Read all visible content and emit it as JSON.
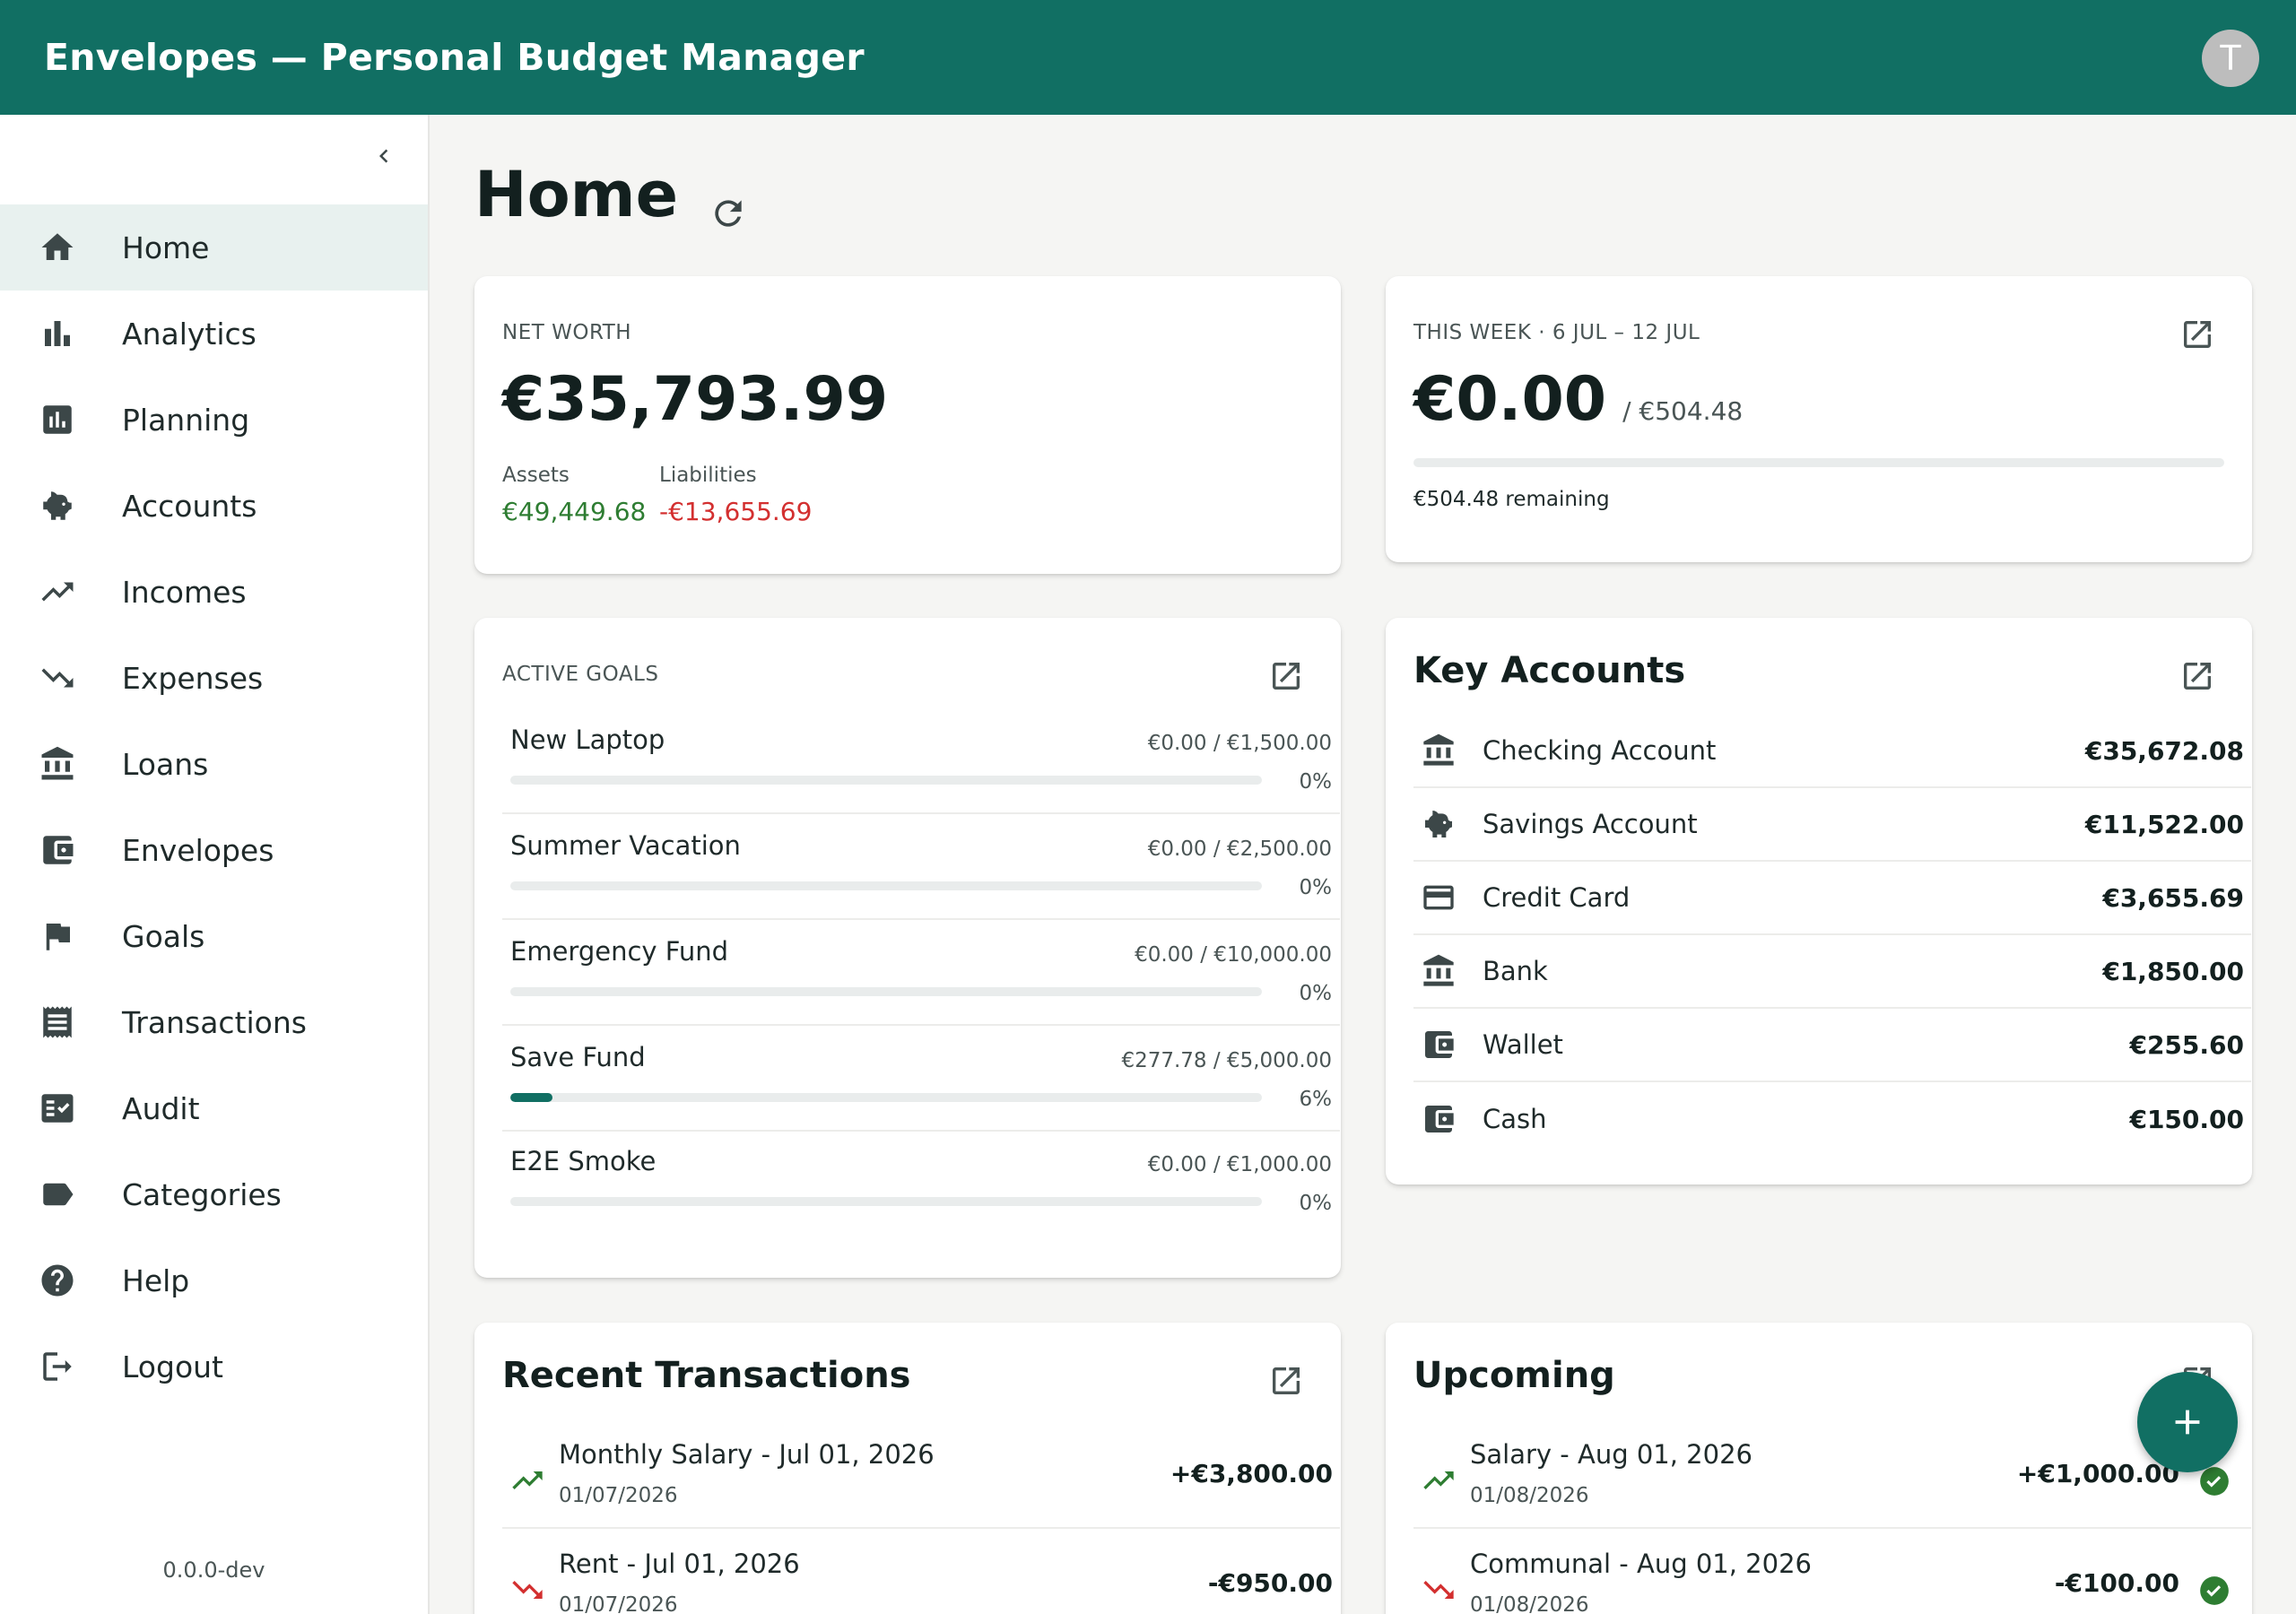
{
  "app": {
    "title": "Envelopes — Personal Budget Manager",
    "avatar_initial": "T"
  },
  "sidebar": {
    "items": [
      {
        "label": "Home",
        "icon": "home-icon",
        "active": true
      },
      {
        "label": "Analytics",
        "icon": "bar-chart-icon"
      },
      {
        "label": "Planning",
        "icon": "planning-chart-icon"
      },
      {
        "label": "Accounts",
        "icon": "piggy-bank-icon"
      },
      {
        "label": "Incomes",
        "icon": "trending-up-icon"
      },
      {
        "label": "Expenses",
        "icon": "trending-down-icon"
      },
      {
        "label": "Loans",
        "icon": "bank-icon"
      },
      {
        "label": "Envelopes",
        "icon": "wallet-icon"
      },
      {
        "label": "Goals",
        "icon": "flag-icon"
      },
      {
        "label": "Transactions",
        "icon": "receipt-icon"
      },
      {
        "label": "Audit",
        "icon": "fact-check-icon"
      },
      {
        "label": "Categories",
        "icon": "label-icon"
      },
      {
        "label": "Help",
        "icon": "help-icon"
      },
      {
        "label": "Logout",
        "icon": "logout-icon"
      }
    ],
    "version": "0.0.0-dev"
  },
  "page": {
    "title": "Home"
  },
  "net_worth": {
    "overline": "NET WORTH",
    "value": "€35,793.99",
    "assets_label": "Assets",
    "assets_value": "€49,449.68",
    "liabilities_label": "Liabilities",
    "liabilities_value": "-€13,655.69"
  },
  "this_week": {
    "overline": "THIS WEEK · 6 JUL – 12 JUL",
    "spent": "€0.00",
    "budget": "/ €504.48",
    "progress": 0,
    "remaining": "€504.48 remaining"
  },
  "goals": {
    "overline": "ACTIVE GOALS",
    "items": [
      {
        "name": "New Laptop",
        "amount": "€0.00 / €1,500.00",
        "pct_label": "0%",
        "progress": 0
      },
      {
        "name": "Summer Vacation",
        "amount": "€0.00 / €2,500.00",
        "pct_label": "0%",
        "progress": 0
      },
      {
        "name": "Emergency Fund",
        "amount": "€0.00 / €10,000.00",
        "pct_label": "0%",
        "progress": 0
      },
      {
        "name": "Save Fund",
        "amount": "€277.78 / €5,000.00",
        "pct_label": "6%",
        "progress": 0.0556
      },
      {
        "name": "E2E Smoke",
        "amount": "€0.00 / €1,000.00",
        "pct_label": "0%",
        "progress": 0
      }
    ]
  },
  "key_accounts": {
    "title": "Key Accounts",
    "items": [
      {
        "name": "Checking Account",
        "balance": "€35,672.08",
        "icon": "bank-icon"
      },
      {
        "name": "Savings Account",
        "balance": "€11,522.00",
        "icon": "piggy-bank-icon"
      },
      {
        "name": "Credit Card",
        "balance": "€3,655.69",
        "icon": "credit-card-icon"
      },
      {
        "name": "Bank",
        "balance": "€1,850.00",
        "icon": "bank-icon"
      },
      {
        "name": "Wallet",
        "balance": "€255.60",
        "icon": "wallet-icon"
      },
      {
        "name": "Cash",
        "balance": "€150.00",
        "icon": "wallet-icon"
      }
    ]
  },
  "recent_transactions": {
    "title": "Recent Transactions",
    "items": [
      {
        "title": "Monthly Salary - Jul 01, 2026",
        "date": "01/07/2026",
        "amount": "+€3,800.00",
        "kind": "income"
      },
      {
        "title": "Rent - Jul 01, 2026",
        "date": "01/07/2026",
        "amount": "-€950.00",
        "kind": "expense"
      }
    ]
  },
  "upcoming": {
    "title": "Upcoming",
    "items": [
      {
        "title": "Salary - Aug 01, 2026",
        "date": "01/08/2026",
        "amount": "+€1,000.00",
        "kind": "income"
      },
      {
        "title": "Communal - Aug 01, 2026",
        "date": "01/08/2026",
        "amount": "-€100.00",
        "kind": "expense"
      }
    ]
  },
  "colors": {
    "brand": "#116f63",
    "positive": "#2e7d32",
    "negative": "#d32f2f",
    "check": "#2e7d32"
  }
}
